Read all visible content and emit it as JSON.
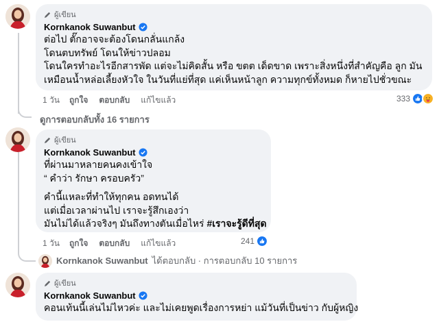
{
  "comments": [
    {
      "role": "ผู้เขียน",
      "author": "Kornkanok Suwanbut",
      "lines": [
        "ต่อไป ตั๊กอาจจะต้องโดนกลั่นแกล้ง",
        "โดนตบทรัพย์ โดนให้ข่าวปลอม",
        "โดนใครทำอะไรอีกสารพัด แต่จะไม่คิดสั้น หรือ ขตต เด็ดขาด เพราะสิ่งหนึ่งที่สำคัญคือ ลูก มัน",
        "เหมือนน้ำหล่อเลี้ยงหัวใจ ในวันที่แย่ที่สุด แค่เห็นหน้าลูก ความทุกข์ทั้งหมด ก็หายไปชั่วขณะ"
      ],
      "time": "1 วัน",
      "like": "ถูกใจ",
      "reply": "ตอบกลับ",
      "edited": "แก้ไขแล้ว",
      "reaction_count": "333",
      "view_replies": "ดูการตอบกลับทั้ง 16 รายการ"
    },
    {
      "role": "ผู้เขียน",
      "author": "Kornkanok Suwanbut",
      "lines": [
        "ที่ผ่านมาหลายคนคงเข้าใจ",
        "“ คำว่า รักษา ครอบครัว”",
        "คำนี้แหละที่ทำให้ทุกคน อดทนได้",
        "แต่เมื่อเวลาผ่านไป เราจะรู้สึกเองว่า",
        "มันไม่ได้แล้วจริงๆ มันถึงทางตันเมื่อไหร่ "
      ],
      "hashtag": "#เราจะรู้ดีที่สุด",
      "time": "1 วัน",
      "like": "ถูกใจ",
      "reply": "ตอบกลับ",
      "edited": "แก้ไขแล้ว",
      "reaction_count": "241",
      "reply_author": "Kornkanok Suwanbut",
      "reply_text": "ได้ตอบกลับ · การตอบกลับ 10 รายการ"
    },
    {
      "role": "ผู้เขียน",
      "author": "Kornkanok Suwanbut",
      "lines": [
        "คอนเท้นนี้เล่นไม่ไหวค่ะ และไม่เคยพูดเรื่องการหย่า แม้วันที่เป็นข่าว กับผู้หญิง"
      ]
    }
  ],
  "colors": {
    "like_blue": "#1877f2",
    "care_yellow": "#f7b125",
    "verified_blue": "#1877f2",
    "bubble_bg": "#f0f2f5",
    "muted_text": "#65676b"
  },
  "icons": [
    "pen-icon",
    "verified-icon",
    "like-reaction-icon",
    "care-reaction-icon"
  ]
}
